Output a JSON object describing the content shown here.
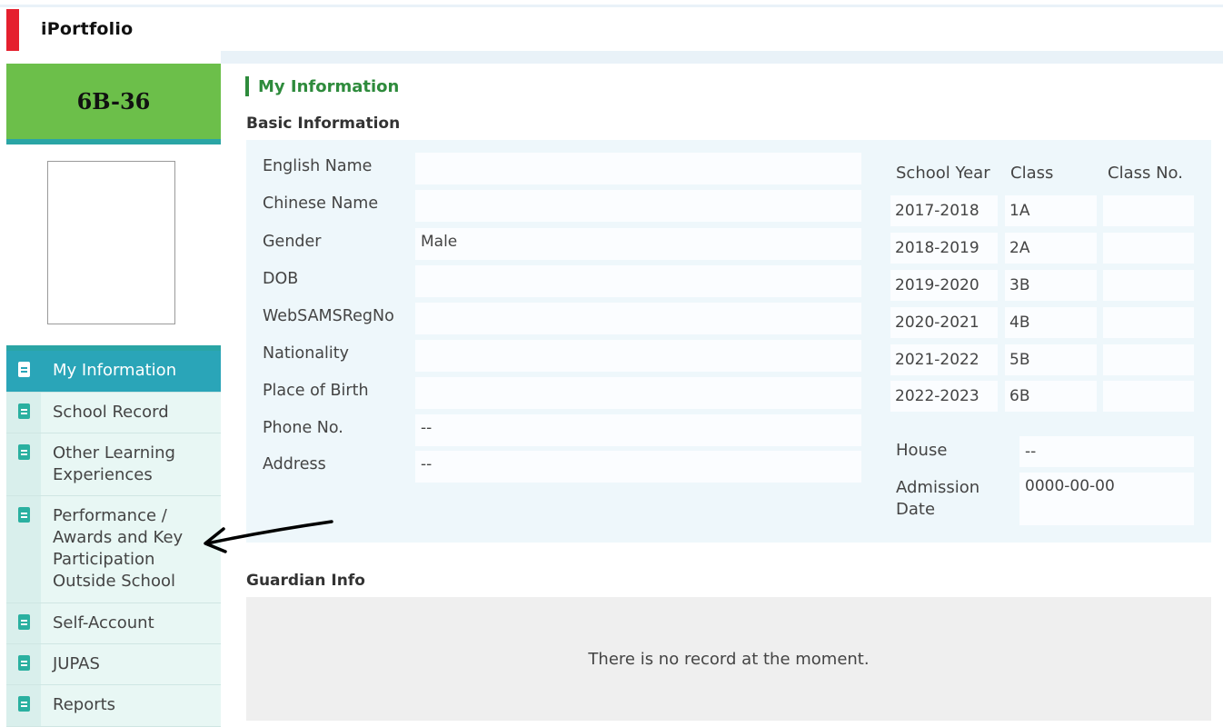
{
  "app": {
    "title": "iPortfolio"
  },
  "sidebar": {
    "class_no": "6B-36",
    "menu": [
      {
        "label": "My Information",
        "active": true,
        "icon": "document-icon"
      },
      {
        "label": "School Record",
        "active": false,
        "icon": "document-icon"
      },
      {
        "label": "Other Learning Experiences",
        "active": false,
        "icon": "document-icon"
      },
      {
        "label": "Performance / Awards and Key Participation Outside School",
        "active": false,
        "icon": "document-icon"
      },
      {
        "label": "Self-Account",
        "active": false,
        "icon": "document-icon"
      },
      {
        "label": "JUPAS",
        "active": false,
        "icon": "document-icon"
      },
      {
        "label": "Reports",
        "active": false,
        "icon": "document-icon"
      }
    ]
  },
  "main": {
    "section_title": "My Information",
    "basic_title": "Basic Information",
    "fields": [
      {
        "label": "English Name",
        "value": ""
      },
      {
        "label": "Chinese Name",
        "value": ""
      },
      {
        "label": "Gender",
        "value": "Male"
      },
      {
        "label": "DOB",
        "value": ""
      },
      {
        "label": "WebSAMSRegNo",
        "value": ""
      },
      {
        "label": "Nationality",
        "value": ""
      },
      {
        "label": "Place of Birth",
        "value": ""
      },
      {
        "label": "Phone No.",
        "value": "--"
      },
      {
        "label": "Address",
        "value": "--"
      }
    ],
    "class_history": {
      "headers": [
        "School Year",
        "Class",
        "Class No."
      ],
      "rows": [
        {
          "year": "2017-2018",
          "class": "1A",
          "class_no": ""
        },
        {
          "year": "2018-2019",
          "class": "2A",
          "class_no": ""
        },
        {
          "year": "2019-2020",
          "class": "3B",
          "class_no": ""
        },
        {
          "year": "2020-2021",
          "class": "4B",
          "class_no": ""
        },
        {
          "year": "2021-2022",
          "class": "5B",
          "class_no": ""
        },
        {
          "year": "2022-2023",
          "class": "6B",
          "class_no": ""
        }
      ]
    },
    "house": {
      "label": "House",
      "value": "--"
    },
    "admission": {
      "label_line1": "Admission",
      "label_line2": "Date",
      "value": "0000-00-00"
    },
    "guardian": {
      "title": "Guardian Info",
      "empty_text": "There is no record at the moment."
    }
  },
  "colors": {
    "accent_green": "#6cbf4a",
    "teal": "#2aa5b8",
    "brand_red": "#e5202e",
    "title_green": "#2e8b3c"
  }
}
